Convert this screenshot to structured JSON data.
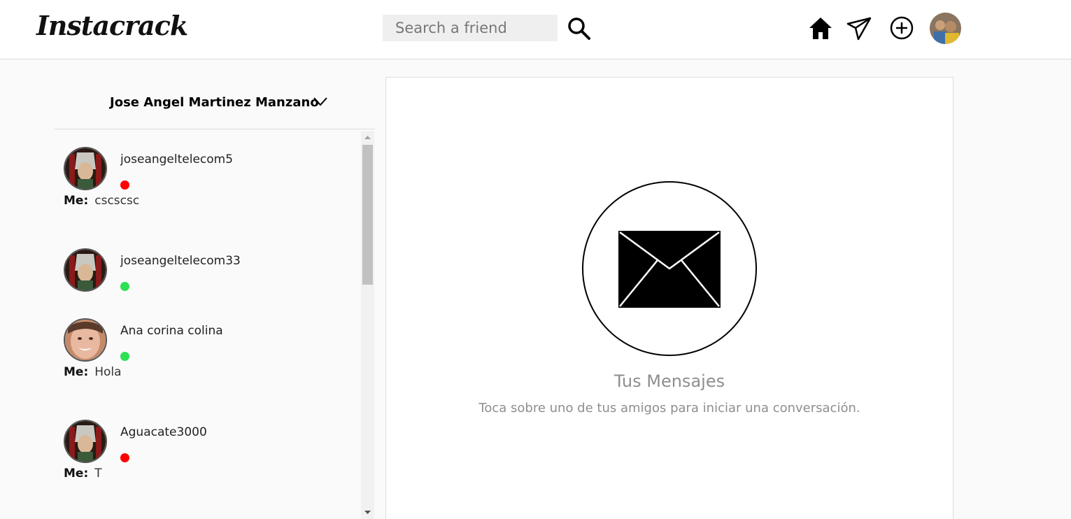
{
  "app": {
    "logo": "Instacrack"
  },
  "search": {
    "placeholder": "Search a friend",
    "value": ""
  },
  "nav": {
    "icons": [
      "home-icon",
      "direct-message-icon",
      "new-post-icon",
      "profile-avatar"
    ]
  },
  "account": {
    "name": "Jose Angel Martinez Manzano"
  },
  "chats": [
    {
      "username": "joseangeltelecom5",
      "status": "offline",
      "me_label": "Me:",
      "last_message": "cscscsc"
    },
    {
      "username": "joseangeltelecom33",
      "status": "online",
      "me_label": "",
      "last_message": ""
    },
    {
      "username": "Ana corina colina",
      "status": "online",
      "me_label": "Me:",
      "last_message": "Hola"
    },
    {
      "username": "Aguacate3000",
      "status": "offline",
      "me_label": "Me:",
      "last_message": "T"
    }
  ],
  "empty_state": {
    "title": "Tus Mensajes",
    "subtitle": "Toca sobre uno de tus amigos para iniciar una conversación."
  },
  "colors": {
    "online": "#2ee054",
    "offline": "#ff0000",
    "muted_text": "#8e8e8e"
  }
}
